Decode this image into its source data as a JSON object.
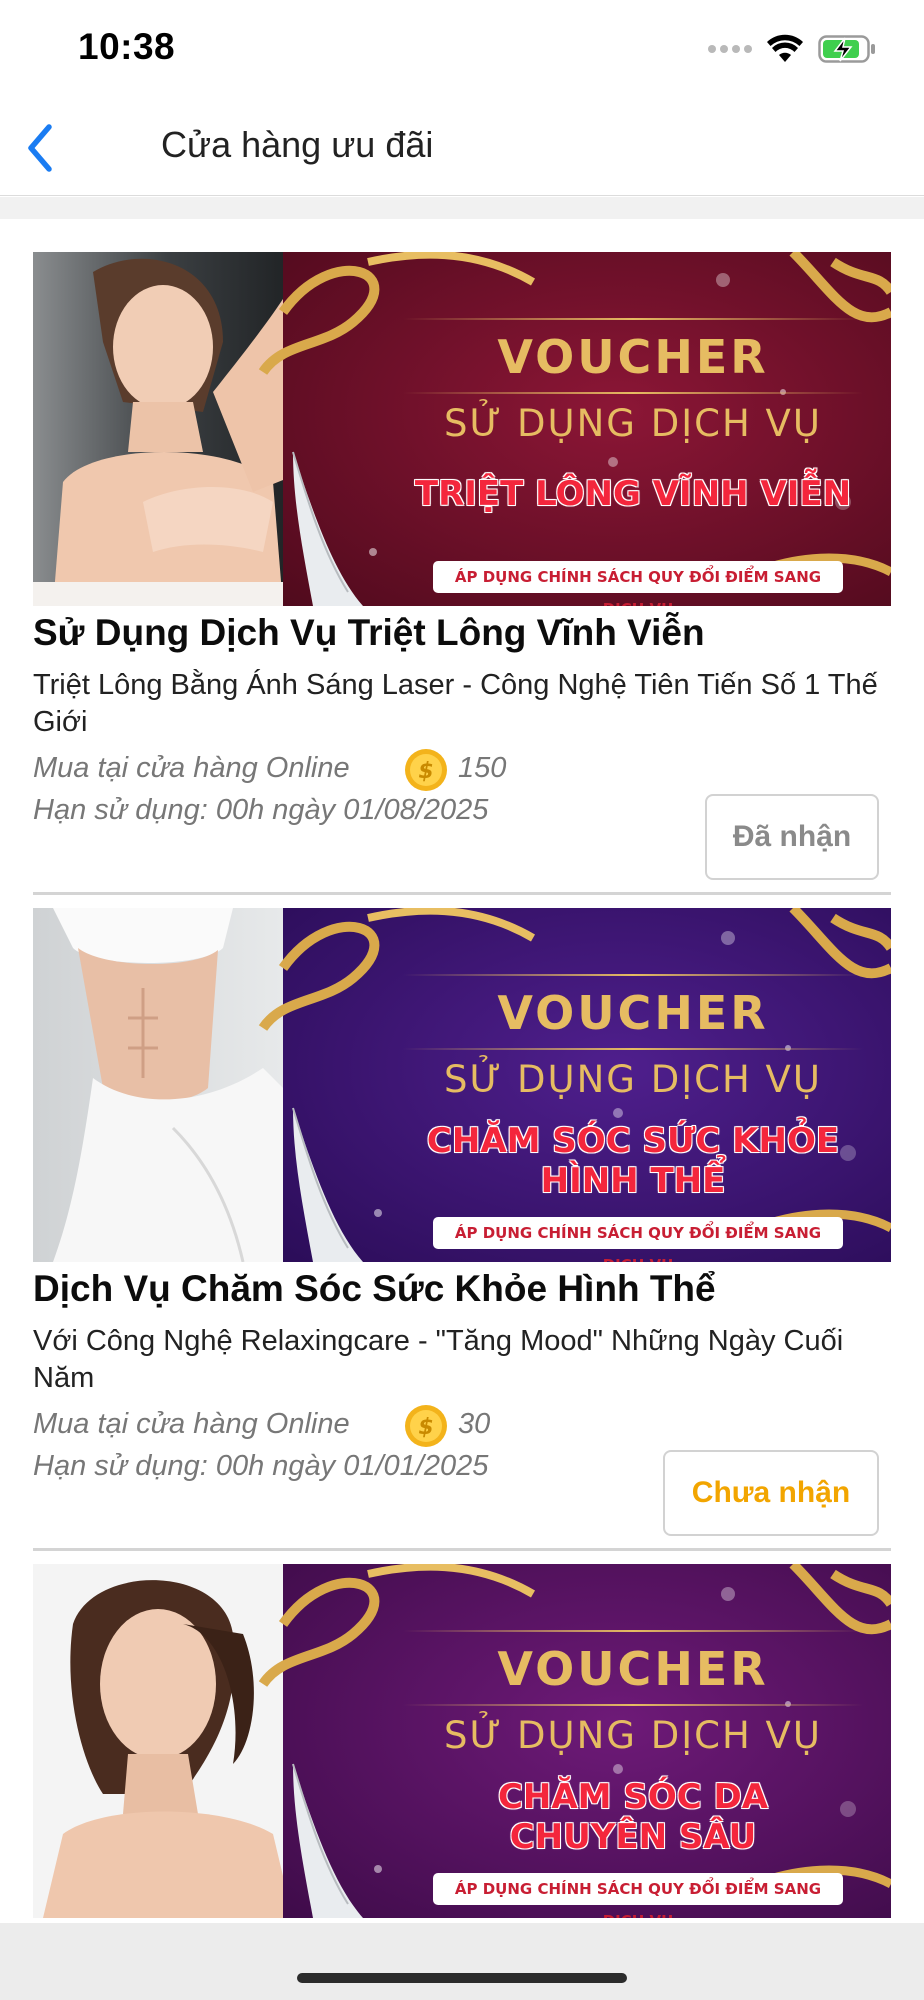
{
  "status_bar": {
    "time": "10:38"
  },
  "nav": {
    "title": "Cửa hàng ưu đãi"
  },
  "colors": {
    "accent": "#f2a500",
    "claimed_text": "#8a8a8a",
    "back_arrow": "#1a7cf2",
    "banner_gold": "#e6bc62",
    "banner_red": "#f4263c"
  },
  "vouchers": [
    {
      "banner": {
        "kicker": "VOUCHER",
        "sub": "SỬ DỤNG DỊCH VỤ",
        "main_line1": "TRIỆT LÔNG VĨNH VIỄN",
        "main_line2": "",
        "note": "ÁP DỤNG CHÍNH SÁCH QUY ĐỔI ĐIỂM SANG DỊCH VỤ"
      },
      "title": "Sử Dụng Dịch Vụ Triệt Lông Vĩnh Viễn",
      "description": "Triệt Lông Bằng Ánh Sáng Laser - Công Nghệ Tiên Tiến Số 1 Thế Giới",
      "store": "Mua tại cửa hàng Online",
      "points": "150",
      "expiry": "Hạn sử dụng: 00h ngày 01/08/2025",
      "button_label": "Đã nhận"
    },
    {
      "banner": {
        "kicker": "VOUCHER",
        "sub": "SỬ DỤNG DỊCH VỤ",
        "main_line1": "CHĂM SÓC SỨC KHỎE",
        "main_line2": "HÌNH THỂ",
        "note": "ÁP DỤNG CHÍNH SÁCH QUY ĐỔI ĐIỂM SANG DỊCH VỤ"
      },
      "title": "Dịch Vụ Chăm Sóc Sức Khỏe Hình Thể",
      "description": "Với Công Nghệ Relaxingcare - \"Tăng Mood\" Những Ngày Cuối Năm",
      "store": "Mua tại cửa hàng Online",
      "points": "30",
      "expiry": "Hạn sử dụng: 00h ngày 01/01/2025",
      "button_label": "Chưa nhận"
    },
    {
      "banner": {
        "kicker": "VOUCHER",
        "sub": "SỬ DỤNG DỊCH VỤ",
        "main_line1": "CHĂM SÓC DA",
        "main_line2": "CHUYÊN SÂU",
        "note": "ÁP DỤNG CHÍNH SÁCH QUY ĐỔI ĐIỂM SANG DỊCH VỤ"
      }
    }
  ]
}
